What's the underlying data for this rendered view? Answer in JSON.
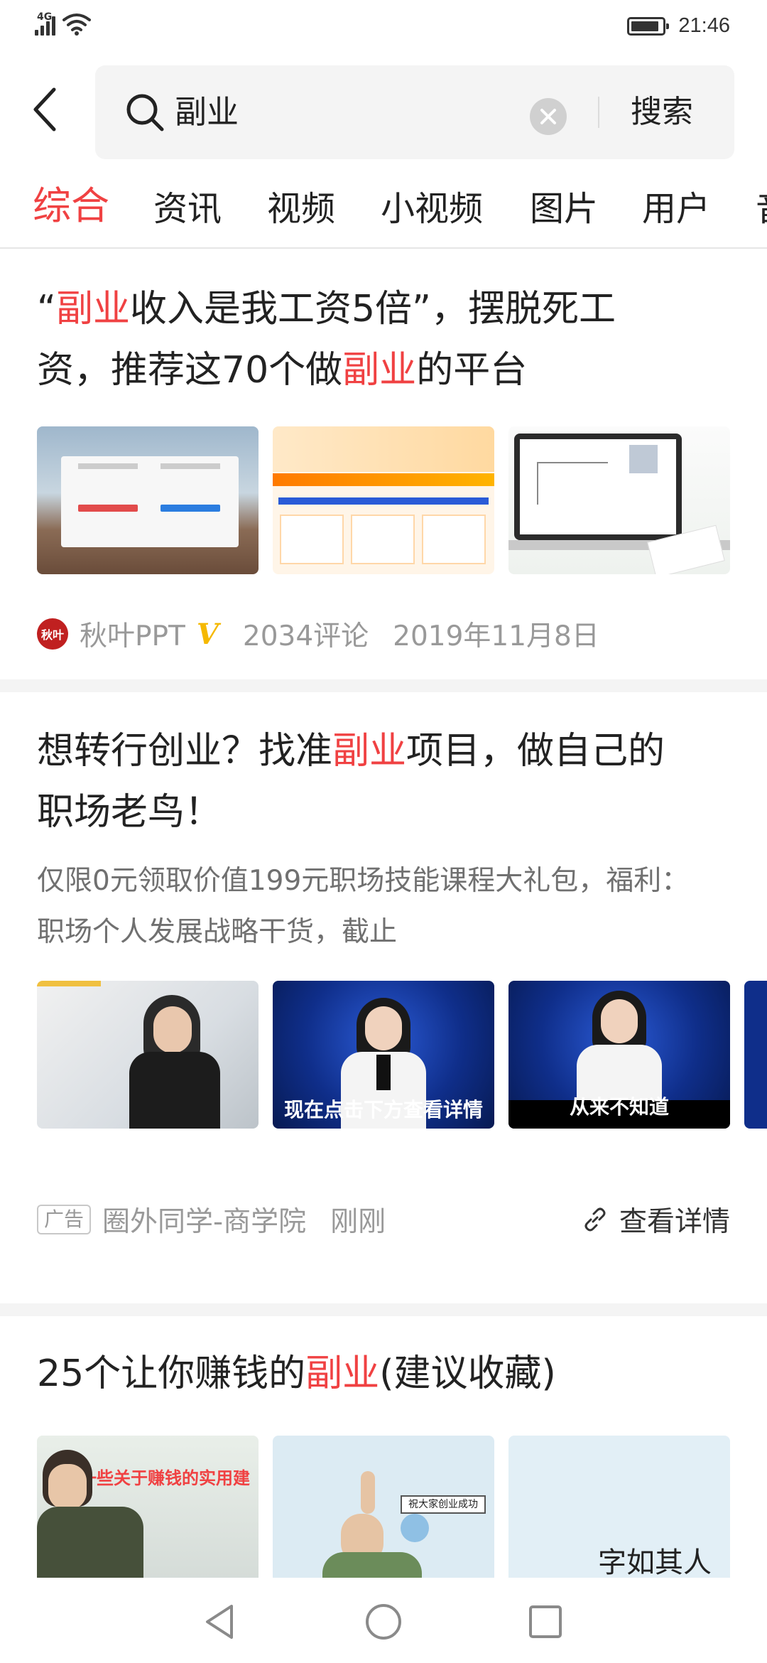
{
  "status_bar": {
    "network": "4G",
    "time": "21:46"
  },
  "search": {
    "query": "副业",
    "submit_label": "搜索"
  },
  "tabs": [
    {
      "label": "综合",
      "active": true
    },
    {
      "label": "资讯",
      "active": false
    },
    {
      "label": "视频",
      "active": false
    },
    {
      "label": "小视频",
      "active": false
    },
    {
      "label": "图片",
      "active": false
    },
    {
      "label": "用户",
      "active": false
    },
    {
      "label": "音",
      "active": false
    }
  ],
  "articles": [
    {
      "title_line1_pre": "“",
      "title_line1_hl": "副业",
      "title_line1_post": "收入是我工资5倍”，摆脱死工",
      "title_line2_pre": "资，推荐这70个做",
      "title_line2_hl": "副业",
      "title_line2_post": "的平台",
      "author": "秋叶PPT",
      "avatar_text": "秋叶",
      "verified": "V",
      "comments": "2034评论",
      "date": "2019年11月8日"
    },
    {
      "title_line1_pre": "想转行创业？找准",
      "title_line1_hl": "副业",
      "title_line1_post": "项目，做自己的",
      "title_line2": "职场老鸟！",
      "desc_line1": "仅限0元领取价值199元职场技能课程大礼包，福利：",
      "desc_line2": "职场个人发展战略干货，截止",
      "thumb_captions": [
        "现在点击下方查看详情",
        "从来不知道"
      ],
      "ad_tag": "广告",
      "source": "圈外同学-商学院",
      "time": "刚刚",
      "detail_label": "查看详情"
    },
    {
      "title_pre": "25个让你赚钱的",
      "title_hl": "副业",
      "title_post": "(建议收藏)",
      "thumb1_text": "一些关于赚钱的实用建",
      "thumb2_text": "祝大家创业成功",
      "thumb3_text": "字如其人"
    }
  ],
  "colors": {
    "accent": "#f04142",
    "text_primary": "#222222",
    "text_secondary": "#999999",
    "verified": "#f5b800"
  }
}
